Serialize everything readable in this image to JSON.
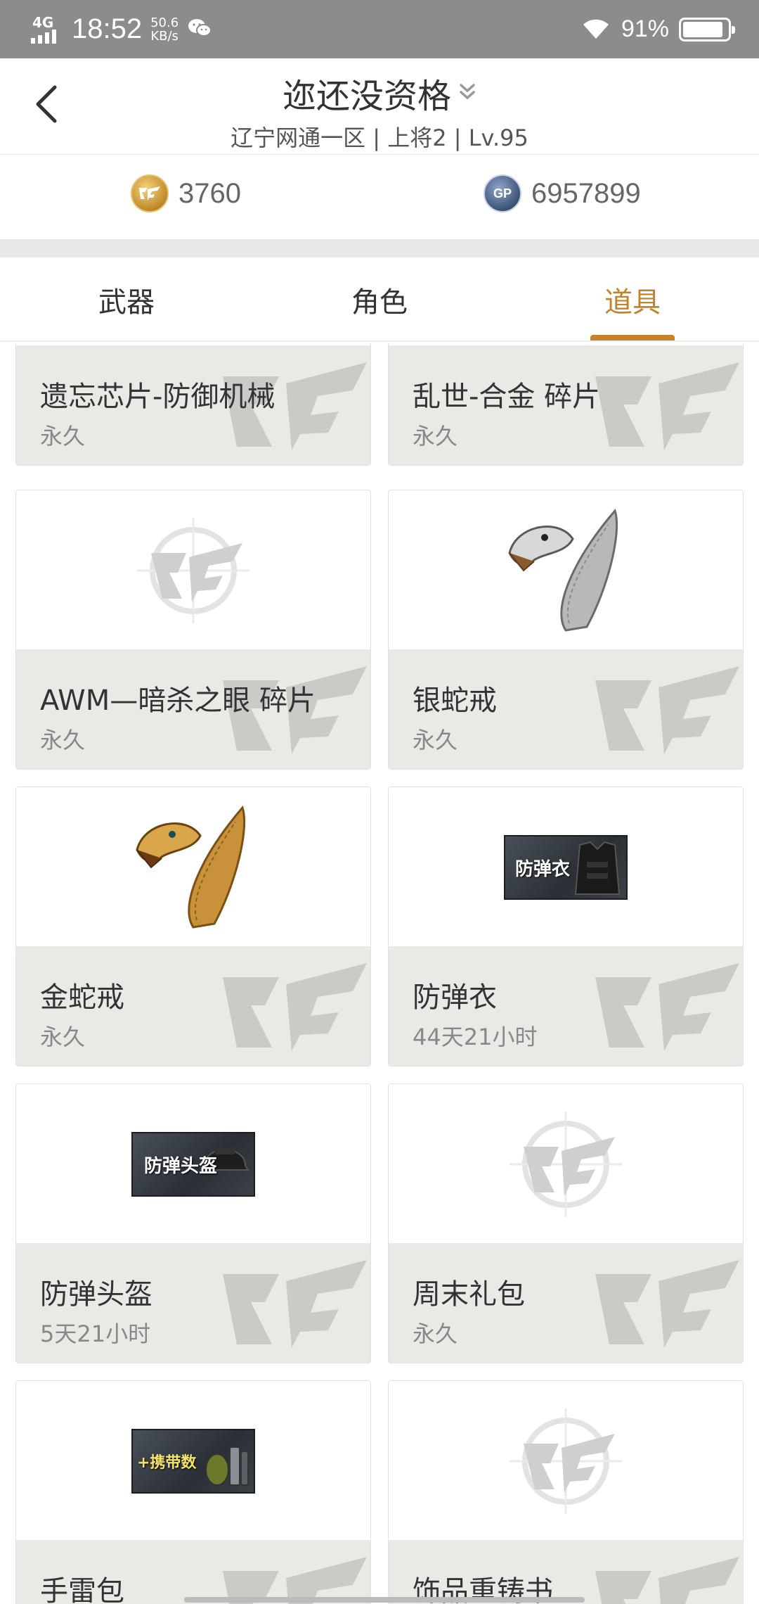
{
  "status_bar": {
    "network": "4G",
    "time": "18:52",
    "speed_value": "50.6",
    "speed_unit": "KB/s",
    "battery": "91%"
  },
  "header": {
    "title": "迩还没资格",
    "subtitle": "辽宁网通一区 | 上将2 | Lv.95"
  },
  "currency": {
    "cf_value": "3760",
    "gp_label": "GP",
    "gp_value": "6957899"
  },
  "tabs": [
    {
      "label": "武器",
      "active": false
    },
    {
      "label": "角色",
      "active": false
    },
    {
      "label": "道具",
      "active": true
    }
  ],
  "items": [
    {
      "name": "遗忘芯片-防御机械",
      "duration": "永久",
      "icon": "cf-placeholder-icon"
    },
    {
      "name": "乱世-合金 碎片",
      "duration": "永久",
      "icon": "cf-placeholder-icon"
    },
    {
      "name": "AWM—暗杀之眼 碎片",
      "duration": "永久",
      "icon": "cf-placeholder-icon"
    },
    {
      "name": "银蛇戒",
      "duration": "永久",
      "icon": "silver-snake-ring-icon"
    },
    {
      "name": "金蛇戒",
      "duration": "永久",
      "icon": "gold-snake-ring-icon"
    },
    {
      "name": "防弹衣",
      "duration": "44天21小时",
      "icon": "body-armor-icon",
      "badge": "防弹衣"
    },
    {
      "name": "防弹头盔",
      "duration": "5天21小时",
      "icon": "helmet-icon",
      "badge": "防弹头盔"
    },
    {
      "name": "周末礼包",
      "duration": "永久",
      "icon": "cf-placeholder-icon"
    },
    {
      "name": "手雷包",
      "duration": "",
      "icon": "grenade-pack-icon",
      "badge": "+携带数"
    },
    {
      "name": "饰品重铸书",
      "duration": "",
      "icon": "cf-placeholder-icon"
    }
  ]
}
